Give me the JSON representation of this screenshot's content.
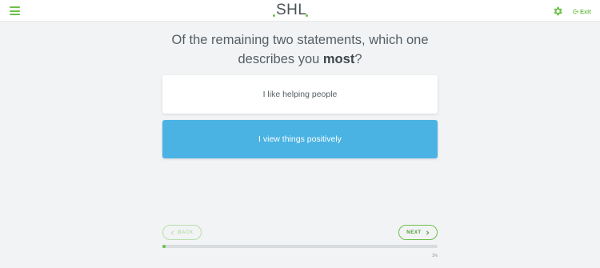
{
  "header": {
    "logo_text": "SHL",
    "exit_label": "Exit"
  },
  "question": {
    "line1": "Of the remaining two statements, which one",
    "line2_prefix": "describes you ",
    "line2_emphasis": "most",
    "line2_suffix": "?"
  },
  "options": [
    {
      "label": "I like helping people"
    },
    {
      "label": "I view things positively"
    }
  ],
  "navigation": {
    "back_label": "BACK",
    "next_label": "NEXT"
  },
  "progress": {
    "value_percent": 1,
    "label": "1%"
  },
  "colors": {
    "accent_green": "#6cc04a",
    "selected_option": "#4ab3e3",
    "background": "#f2f3f5"
  },
  "icons": {
    "menu": "hamburger-icon",
    "settings": "gear-icon",
    "exit": "exit-icon",
    "back": "chevron-left-icon",
    "next": "chevron-right-icon"
  }
}
